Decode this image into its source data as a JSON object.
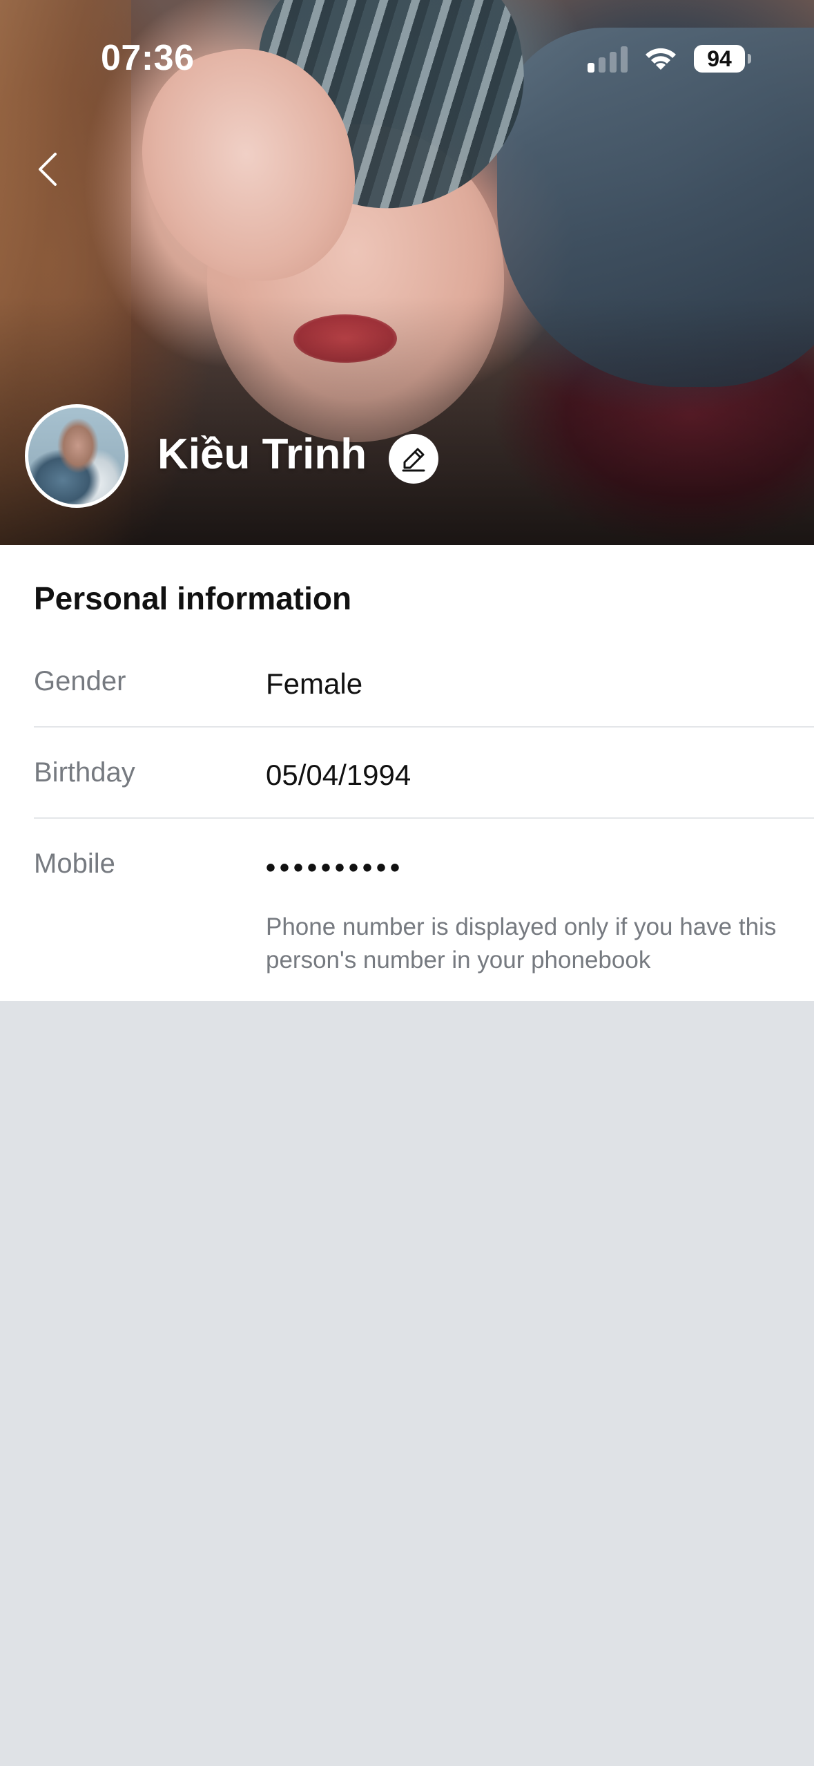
{
  "status_bar": {
    "time": "07:36",
    "battery": "94",
    "signal_bars_active": 1,
    "signal_bars_total": 4
  },
  "header": {
    "back_icon": "chevron-left-icon",
    "profile_name": "Kiều Trinh",
    "edit_icon": "pencil-icon"
  },
  "personal_info": {
    "title": "Personal information",
    "rows": [
      {
        "label": "Gender",
        "value": "Female"
      },
      {
        "label": "Birthday",
        "value": "05/04/1994"
      },
      {
        "label": "Mobile",
        "value": "••••••••••",
        "note": "Phone number is displayed only if you have this person's number in your phonebook"
      }
    ]
  },
  "colors": {
    "page_background": "#dfe2e6",
    "card_background": "#ffffff",
    "label_gray": "#767a80",
    "text_dark": "#111111"
  }
}
